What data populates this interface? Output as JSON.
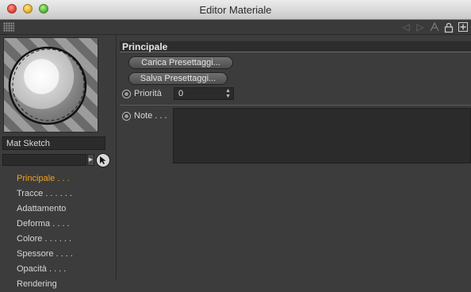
{
  "window": {
    "title": "Editor Materiale"
  },
  "material": {
    "name": "Mat Sketch"
  },
  "nav": [
    {
      "label": "Principale . . ."
    },
    {
      "label": "Tracce . . . . . ."
    },
    {
      "label": "Adattamento"
    },
    {
      "label": "Deforma . . . ."
    },
    {
      "label": "Colore . . . . . ."
    },
    {
      "label": "Spessore . . . ."
    },
    {
      "label": "Opacità . . . ."
    },
    {
      "label": "Rendering"
    }
  ],
  "section": {
    "title": "Principale"
  },
  "buttons": {
    "load_presets": "Carica Presettaggi...",
    "save_presets": "Salva Presettaggi..."
  },
  "fields": {
    "priority": {
      "label": "Priorità",
      "value": "0"
    },
    "notes": {
      "label": "Note . . ."
    }
  },
  "toolbar": {
    "icons": [
      "grip-icon",
      "arrow-left-icon",
      "arrow-right-icon",
      "text-a-icon",
      "lock-icon",
      "add-panel-icon"
    ]
  },
  "colors": {
    "accent_active": "#f0a020",
    "panel_bg": "#3c3c3c"
  }
}
